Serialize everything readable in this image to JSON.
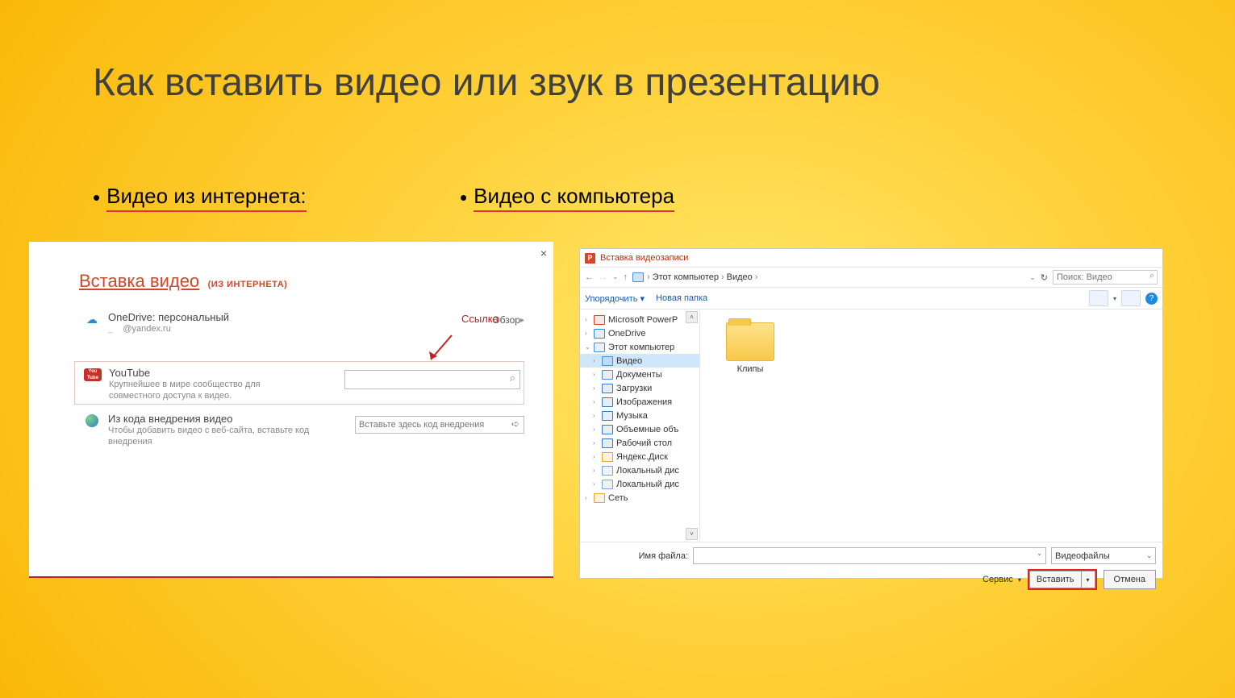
{
  "title": "Как вставить видео или звук в презентацию",
  "bullets": {
    "left": "Видео из интернета:",
    "right": "Видео  с компьютера"
  },
  "left_dialog": {
    "header_main": "Вставка видео",
    "header_sub": "(ИЗ ИНТЕРНЕТА)",
    "close": "×",
    "annotation": "Ссылка",
    "rows": {
      "onedrive": {
        "title": "OneDrive: персональный",
        "subtitle": "@yandex.ru",
        "browse": "Обзор"
      },
      "youtube": {
        "title": "YouTube",
        "subtitle": "Крупнейшее в мире сообщество для совместного доступа к видео.",
        "yt_label_top": "You",
        "yt_label_bottom": "Tube"
      },
      "embed": {
        "title": "Из кода внедрения видео",
        "subtitle": "Чтобы добавить видео с веб-сайта, вставьте код внедрения",
        "placeholder": "Вставьте здесь код внедрения"
      }
    }
  },
  "right_dialog": {
    "window_title": "Вставка видеозаписи",
    "breadcrumb": [
      "Этот компьютер",
      "Видео"
    ],
    "search_placeholder": "Поиск: Видео",
    "toolbar": {
      "organize": "Упорядочить ▾",
      "new_folder": "Новая папка"
    },
    "tree": [
      {
        "label": "Microsoft PowerP",
        "caret": "›",
        "icon": "p",
        "color": "#d24726"
      },
      {
        "label": "OneDrive",
        "caret": "›",
        "icon": "cloud",
        "color": "#2a8dd4"
      },
      {
        "label": "Этот компьютер",
        "caret": "⌄",
        "icon": "pc",
        "color": "#4a90d9"
      },
      {
        "label": "Видео",
        "caret": "›",
        "icon": "vid",
        "color": "#4a90d9",
        "selected": true,
        "indent": true
      },
      {
        "label": "Документы",
        "caret": "›",
        "icon": "doc",
        "color": "#4a90d9",
        "indent": true
      },
      {
        "label": "Загрузки",
        "caret": "›",
        "icon": "dl",
        "color": "#3b78c4",
        "indent": true
      },
      {
        "label": "Изображения",
        "caret": "›",
        "icon": "img",
        "color": "#3b78c4",
        "indent": true
      },
      {
        "label": "Музыка",
        "caret": "›",
        "icon": "mus",
        "color": "#3b78c4",
        "indent": true
      },
      {
        "label": "Объемные объ",
        "caret": "›",
        "icon": "3d",
        "color": "#3b78c4",
        "indent": true
      },
      {
        "label": "Рабочий стол",
        "caret": "›",
        "icon": "desk",
        "color": "#3b78c4",
        "indent": true
      },
      {
        "label": "Яндекс.Диск",
        "caret": "›",
        "icon": "yd",
        "color": "#e8a33d",
        "indent": true
      },
      {
        "label": "Локальный дис",
        "caret": "›",
        "icon": "disk",
        "color": "#7aa4d6",
        "indent": true
      },
      {
        "label": "Локальный дис",
        "caret": "›",
        "icon": "disk",
        "color": "#7aa4d6",
        "indent": true
      },
      {
        "label": "Сеть",
        "caret": "›",
        "icon": "net",
        "color": "#e8a33d"
      }
    ],
    "content_folder": "Клипы",
    "footer": {
      "filename_label": "Имя файла:",
      "filetype": "Видеофайлы",
      "tools": "Сервис",
      "insert": "Вставить",
      "cancel": "Отмена"
    }
  }
}
